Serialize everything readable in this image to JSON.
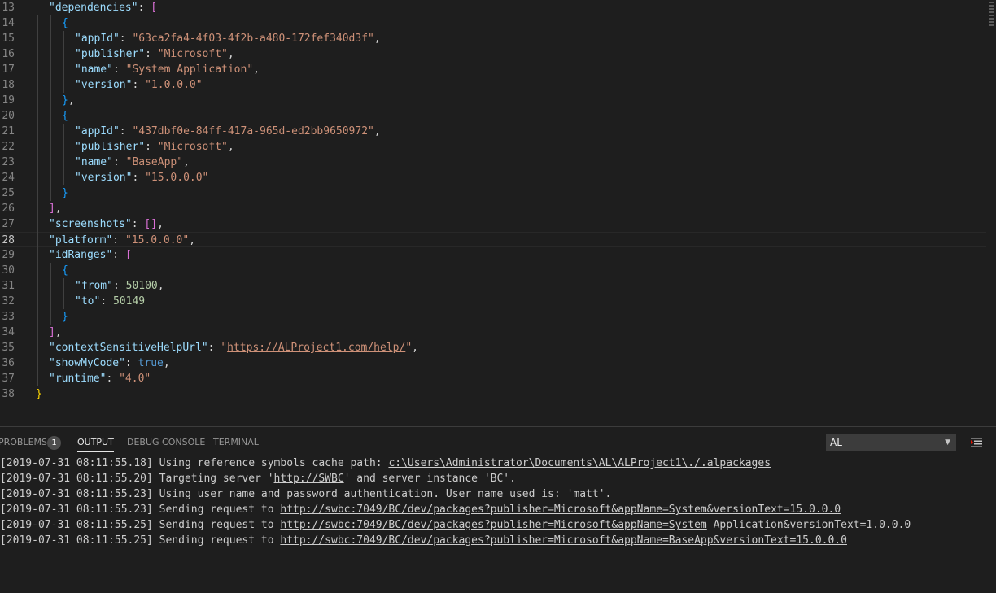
{
  "editor": {
    "lines": [
      {
        "num": "13",
        "parts": [
          [
            "k",
            "\"dependencies\""
          ],
          [
            "",
            "\": \""
          ],
          [
            "p2",
            "["
          ]
        ]
      },
      {
        "num": "14",
        "parts": [
          [
            "p3",
            "{"
          ]
        ]
      },
      {
        "num": "15",
        "parts": [
          [
            "k",
            "\"appId\""
          ],
          [
            "",
            ": "
          ],
          [
            "s",
            "\"63ca2fa4-4f03-4f2b-a480-172fef340d3f\""
          ],
          [
            "",
            ","
          ]
        ]
      },
      {
        "num": "16",
        "parts": [
          [
            "k",
            "\"publisher\""
          ],
          [
            "",
            ": "
          ],
          [
            "s",
            "\"Microsoft\""
          ],
          [
            "",
            ","
          ]
        ]
      },
      {
        "num": "17",
        "parts": [
          [
            "k",
            "\"name\""
          ],
          [
            "",
            ": "
          ],
          [
            "s",
            "\"System Application\""
          ],
          [
            "",
            ","
          ]
        ]
      },
      {
        "num": "18",
        "parts": [
          [
            "k",
            "\"version\""
          ],
          [
            "",
            ": "
          ],
          [
            "s",
            "\"1.0.0.0\""
          ]
        ]
      },
      {
        "num": "19",
        "parts": [
          [
            "p3",
            "}"
          ],
          [
            "",
            ","
          ]
        ]
      },
      {
        "num": "20",
        "parts": [
          [
            "p3",
            "{"
          ]
        ]
      },
      {
        "num": "21",
        "parts": [
          [
            "k",
            "\"appId\""
          ],
          [
            "",
            ": "
          ],
          [
            "s",
            "\"437dbf0e-84ff-417a-965d-ed2bb9650972\""
          ],
          [
            "",
            ","
          ]
        ]
      },
      {
        "num": "22",
        "parts": [
          [
            "k",
            "\"publisher\""
          ],
          [
            "",
            ": "
          ],
          [
            "s",
            "\"Microsoft\""
          ],
          [
            "",
            ","
          ]
        ]
      },
      {
        "num": "23",
        "parts": [
          [
            "k",
            "\"name\""
          ],
          [
            "",
            ": "
          ],
          [
            "s",
            "\"BaseApp\""
          ],
          [
            "",
            ","
          ]
        ]
      },
      {
        "num": "24",
        "parts": [
          [
            "k",
            "\"version\""
          ],
          [
            "",
            ": "
          ],
          [
            "s",
            "\"15.0.0.0\""
          ]
        ]
      },
      {
        "num": "25",
        "parts": [
          [
            "p3",
            "}"
          ]
        ]
      },
      {
        "num": "26",
        "parts": [
          [
            "p2",
            "]"
          ],
          [
            "",
            ","
          ]
        ]
      },
      {
        "num": "27",
        "parts": [
          [
            "k",
            "\"screenshots\""
          ],
          [
            "",
            ": "
          ],
          [
            "p2",
            "[]"
          ],
          [
            "",
            ","
          ]
        ]
      },
      {
        "num": "28",
        "parts": [
          [
            "k",
            "\"platform\""
          ],
          [
            "",
            ": "
          ],
          [
            "s",
            "\"15.0.0.0\""
          ],
          [
            "",
            ","
          ]
        ]
      },
      {
        "num": "29",
        "parts": [
          [
            "k",
            "\"idRanges\""
          ],
          [
            "",
            ": "
          ],
          [
            "p2",
            "["
          ]
        ]
      },
      {
        "num": "30",
        "parts": [
          [
            "p3",
            "{"
          ]
        ]
      },
      {
        "num": "31",
        "parts": [
          [
            "k",
            "\"from\""
          ],
          [
            "",
            ": "
          ],
          [
            "n",
            "50100"
          ],
          [
            "",
            ","
          ]
        ]
      },
      {
        "num": "32",
        "parts": [
          [
            "k",
            "\"to\""
          ],
          [
            "",
            ": "
          ],
          [
            "n",
            "50149"
          ]
        ]
      },
      {
        "num": "33",
        "parts": [
          [
            "p3",
            "}"
          ]
        ]
      },
      {
        "num": "34",
        "parts": [
          [
            "p2",
            "]"
          ],
          [
            "",
            ","
          ]
        ]
      },
      {
        "num": "35",
        "parts": [
          [
            "k",
            "\"contextSensitiveHelpUrl\""
          ],
          [
            "",
            ": "
          ],
          [
            "s",
            "\""
          ],
          [
            "su",
            "https://ALProject1.com/help/"
          ],
          [
            "s",
            "\""
          ],
          [
            "",
            ","
          ]
        ]
      },
      {
        "num": "36",
        "parts": [
          [
            "k",
            "\"showMyCode\""
          ],
          [
            "",
            ": "
          ],
          [
            "b",
            "true"
          ],
          [
            "",
            ","
          ]
        ]
      },
      {
        "num": "37",
        "parts": [
          [
            "k",
            "\"runtime\""
          ],
          [
            "",
            ": "
          ],
          [
            "s",
            "\"4.0\""
          ]
        ]
      },
      {
        "num": "38",
        "parts": [
          [
            "p1",
            "}"
          ]
        ]
      }
    ],
    "current_line": "28"
  },
  "panel": {
    "tabs": {
      "problems": "PROBLEMS",
      "problems_count": "1",
      "output": "OUTPUT",
      "debug_console": "DEBUG CONSOLE",
      "terminal": "TERMINAL"
    },
    "channel_select": "AL",
    "output_lines": [
      {
        "text": "[2019-07-31 08:11:55.18] Using reference symbols cache path: ",
        "link": "c:\\Users\\Administrator\\Documents\\AL\\ALProject1\\./.alpackages",
        "tail": ""
      },
      {
        "text": "[2019-07-31 08:11:55.20] Targeting server '",
        "link": "http://SWBC",
        "tail": "' and server instance 'BC'."
      },
      {
        "text": "[2019-07-31 08:11:55.23] Using user name and password authentication. User name used is: 'matt'.",
        "link": "",
        "tail": ""
      },
      {
        "text": "[2019-07-31 08:11:55.23] Sending request to ",
        "link": "http://swbc:7049/BC/dev/packages?publisher=Microsoft&appName=System&versionText=15.0.0.0",
        "tail": ""
      },
      {
        "text": "[2019-07-31 08:11:55.25] Sending request to ",
        "link": "http://swbc:7049/BC/dev/packages?publisher=Microsoft&appName=System",
        "tail": " Application&versionText=1.0.0.0"
      },
      {
        "text": "[2019-07-31 08:11:55.25] Sending request to ",
        "link": "http://swbc:7049/BC/dev/packages?publisher=Microsoft&appName=BaseApp&versionText=15.0.0.0",
        "tail": ""
      }
    ]
  }
}
